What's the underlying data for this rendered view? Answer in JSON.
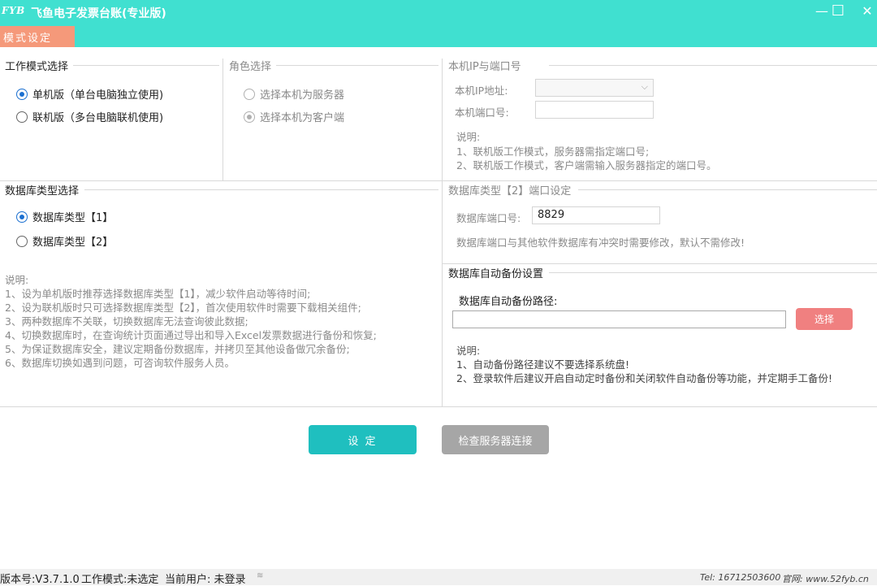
{
  "window": {
    "logo_text": "FYB",
    "title": "飞鱼电子发票台账(专业版)",
    "minimize_glyph": "—",
    "maximize_glyph": "☐",
    "close_glyph": "✕"
  },
  "tabs": {
    "active_label": "模式设定"
  },
  "work_mode": {
    "title": "工作模式选择",
    "options": [
      "单机版（单台电脑独立使用)",
      "联机版（多台电脑联机使用)"
    ],
    "selected_index": 0
  },
  "role": {
    "title": "角色选择",
    "options": [
      "选择本机为服务器",
      "选择本机为客户端"
    ],
    "selected_index": 1
  },
  "ip_port": {
    "title": "本机IP与端口号",
    "ip_label": "本机IP地址:",
    "ip_value": "",
    "port_label": "本机端口号:",
    "port_value": "",
    "note_title": "说明:",
    "notes": [
      "1、联机版工作模式，服务器需指定端口号;",
      "2、联机版工作模式，客户端需输入服务器指定的端口号。"
    ]
  },
  "db_type": {
    "title": "数据库类型选择",
    "options": [
      "数据库类型【1】",
      "数据库类型【2】"
    ],
    "selected_index": 0,
    "note_title": "说明:",
    "notes": [
      "1、设为单机版时推荐选择数据库类型【1】，减少软件启动等待时间;",
      "2、设为联机版时只可选择数据库类型【2】，首次使用软件时需要下载相关组件;",
      "3、两种数据库不关联，切换数据库无法查询彼此数据;",
      "4、切换数据库时，在查询统计页面通过导出和导入Excel发票数据进行备份和恢复;",
      "5、为保证数据库安全，建议定期备份数据库，并拷贝至其他设备做冗余备份;",
      "6、数据库切换如遇到问题，可咨询软件服务人员。"
    ]
  },
  "db_port": {
    "title": "数据库类型【2】端口设定",
    "label": "数据库端口号:",
    "value": "8829",
    "note": "数据库端口与其他软件数据库有冲突时需要修改，默认不需修改!"
  },
  "backup": {
    "title": "数据库自动备份设置",
    "path_label": "数据库自动备份路径:",
    "path_value": "",
    "choose_label": "选择",
    "note_title": "说明:",
    "notes": [
      "1、自动备份路径建议不要选择系统盘!",
      "2、登录软件后建议开启自动定时备份和关闭软件自动备份等功能，并定期手工备份!"
    ]
  },
  "actions": {
    "set_label": "设 定",
    "check_label": "检查服务器连接"
  },
  "status": {
    "version": "版本号:V3.7.1.0",
    "mode": "工作模式:未选定",
    "user": "当前用户:  未登录",
    "tel": "Tel: 16712503600",
    "site": "官网: www.52fyb.cn"
  },
  "colors": {
    "accent": "#40e0d0",
    "tab": "#f5997a",
    "set_button": "#1fbfbf",
    "check_button": "#a6a6a6",
    "choose_button": "#f08080",
    "radio": "#1a6fd0"
  }
}
